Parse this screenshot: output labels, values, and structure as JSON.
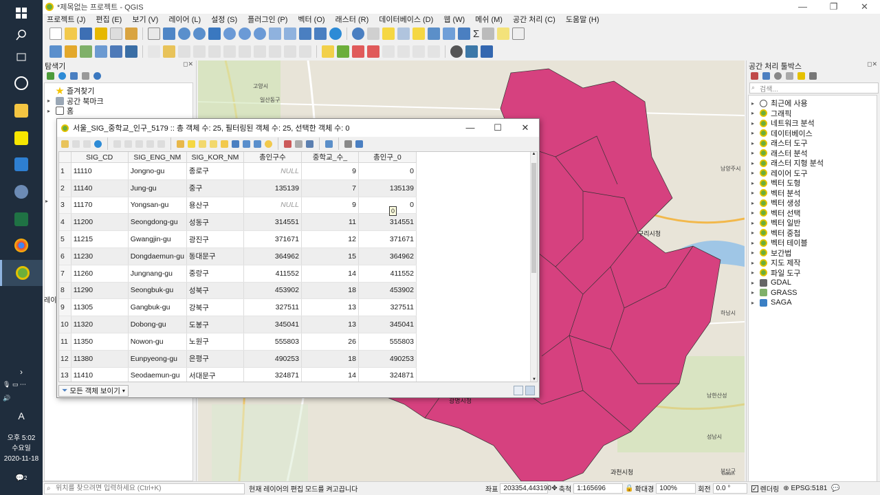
{
  "window": {
    "title": "*제목없는 프로젝트 - QGIS",
    "controls": [
      "—",
      "❐",
      "✕"
    ]
  },
  "menu": [
    "프로젝트 (J)",
    "편집 (E)",
    "보기 (V)",
    "레이어 (L)",
    "설정 (S)",
    "플러그인 (P)",
    "벡터 (O)",
    "래스터 (R)",
    "데이터베이스 (D)",
    "웹 (W)",
    "메쉬 (M)",
    "공간 처리 (C)",
    "도움말 (H)"
  ],
  "browser": {
    "title": "탐색기",
    "items": [
      {
        "label": "즐겨찾기",
        "icon": "star-icon"
      },
      {
        "label": "공간 북마크",
        "icon": "bookmark-icon"
      },
      {
        "label": "홈",
        "icon": "home-icon"
      }
    ],
    "layers_label": "레이",
    "arrow": "▸"
  },
  "toolbox": {
    "title": "공간 처리 툴박스",
    "search_placeholder": "검색...",
    "items": [
      "최근에 사용",
      "그래픽",
      "네트워크 분석",
      "데이터베이스",
      "래스터 도구",
      "래스터 분석",
      "래스터 지형 분석",
      "레이어 도구",
      "벡터 도형",
      "벡터 분석",
      "벡터 생성",
      "벡터 선택",
      "벡터 일반",
      "벡터 중첩",
      "벡터 테이블",
      "보간법",
      "지도 제작",
      "파일 도구",
      "GDAL",
      "GRASS",
      "SAGA"
    ]
  },
  "attribute_table": {
    "title": "서울_SIG_중학교_인구_5179 :: 총 객체 수: 25, 필터링된 객체 수: 25, 선택한 객체 수: 0",
    "columns": [
      "SIG_CD",
      "SIG_ENG_NM",
      "SIG_KOR_NM",
      "총인구수",
      "중학교_수_",
      "총인구_0"
    ],
    "rows": [
      {
        "n": "1",
        "cd": "11110",
        "eng": "Jongno-gu",
        "kor": "종로구",
        "pop": "NULL",
        "school": "9",
        "pop0": "0"
      },
      {
        "n": "2",
        "cd": "11140",
        "eng": "Jung-gu",
        "kor": "중구",
        "pop": "135139",
        "school": "7",
        "pop0": "135139"
      },
      {
        "n": "3",
        "cd": "11170",
        "eng": "Yongsan-gu",
        "kor": "용산구",
        "pop": "NULL",
        "school": "9",
        "pop0": "0"
      },
      {
        "n": "4",
        "cd": "11200",
        "eng": "Seongdong-gu",
        "kor": "성동구",
        "pop": "314551",
        "school": "11",
        "pop0": "314551"
      },
      {
        "n": "5",
        "cd": "11215",
        "eng": "Gwangjin-gu",
        "kor": "광진구",
        "pop": "371671",
        "school": "12",
        "pop0": "371671"
      },
      {
        "n": "6",
        "cd": "11230",
        "eng": "Dongdaemun-gu",
        "kor": "동대문구",
        "pop": "364962",
        "school": "15",
        "pop0": "364962"
      },
      {
        "n": "7",
        "cd": "11260",
        "eng": "Jungnang-gu",
        "kor": "중랑구",
        "pop": "411552",
        "school": "14",
        "pop0": "411552"
      },
      {
        "n": "8",
        "cd": "11290",
        "eng": "Seongbuk-gu",
        "kor": "성북구",
        "pop": "453902",
        "school": "18",
        "pop0": "453902"
      },
      {
        "n": "9",
        "cd": "11305",
        "eng": "Gangbuk-gu",
        "kor": "강북구",
        "pop": "327511",
        "school": "13",
        "pop0": "327511"
      },
      {
        "n": "10",
        "cd": "11320",
        "eng": "Dobong-gu",
        "kor": "도봉구",
        "pop": "345041",
        "school": "13",
        "pop0": "345041"
      },
      {
        "n": "11",
        "cd": "11350",
        "eng": "Nowon-gu",
        "kor": "노원구",
        "pop": "555803",
        "school": "26",
        "pop0": "555803"
      },
      {
        "n": "12",
        "cd": "11380",
        "eng": "Eunpyeong-gu",
        "kor": "은평구",
        "pop": "490253",
        "school": "18",
        "pop0": "490253"
      },
      {
        "n": "13",
        "cd": "11410",
        "eng": "Seodaemun-gu",
        "kor": "서대문구",
        "pop": "324871",
        "school": "14",
        "pop0": "324871"
      }
    ],
    "cell_tooltip": "0",
    "filter_button": "모든 객체 보이기",
    "controls": [
      "—",
      "☐",
      "✕"
    ]
  },
  "map": {
    "polygon_color": "#d6417f",
    "labels": [
      "구리시청",
      "광명시청",
      "과천시청",
      "성남시",
      "남양주시",
      "하남시",
      "분당구",
      "고양시",
      "일산동구",
      "즐겨찾기",
      "남한산성",
      "Daum"
    ]
  },
  "statusbar": {
    "search_placeholder": "위치를 찾으려면 입력하세요 (Ctrl+K)",
    "message": "현재 레이어의 편집 모드를 켜고끕니다",
    "coord_label": "좌표",
    "coord_value": "203354,443190",
    "scale_label": "축척",
    "scale_value": "1:165696",
    "magnifier_label": "확대경",
    "magnifier_value": "100%",
    "rotation_label": "회전",
    "rotation_value": "0.0 °",
    "render_label": "렌더링",
    "crs": "EPSG:5181"
  },
  "taskbar": {
    "time": "오후 5:02",
    "day": "수요일",
    "date": "2020-11-18",
    "ime": "A",
    "notif": "2"
  }
}
